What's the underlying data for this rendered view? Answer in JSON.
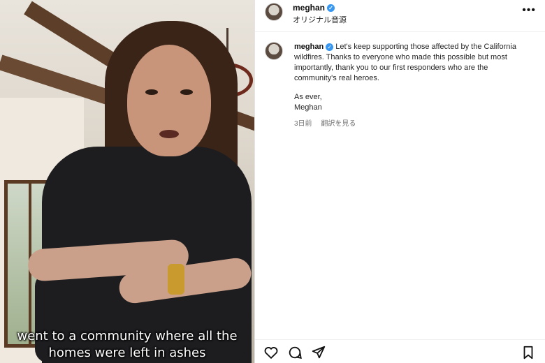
{
  "video": {
    "caption": "went to a community where all the homes were left in ashes"
  },
  "header": {
    "username": "meghan",
    "audio_label": "オリジナル音源",
    "more_label": "•••"
  },
  "post": {
    "username": "meghan",
    "body": "Let's keep supporting those affected by the California wildfires. Thanks to everyone who made this possible but most importantly, thank you to our first responders who are the community's real heroes.",
    "signoff_line1": "As ever,",
    "signoff_line2": "Meghan",
    "time_ago": "3日前",
    "translate_label": "翻訳を見る"
  },
  "actions": {
    "icons": [
      "heart-icon",
      "comment-icon",
      "share-icon",
      "bookmark-icon"
    ]
  },
  "colors": {
    "verified": "#3897f0",
    "text": "#262626",
    "muted": "#737373"
  }
}
